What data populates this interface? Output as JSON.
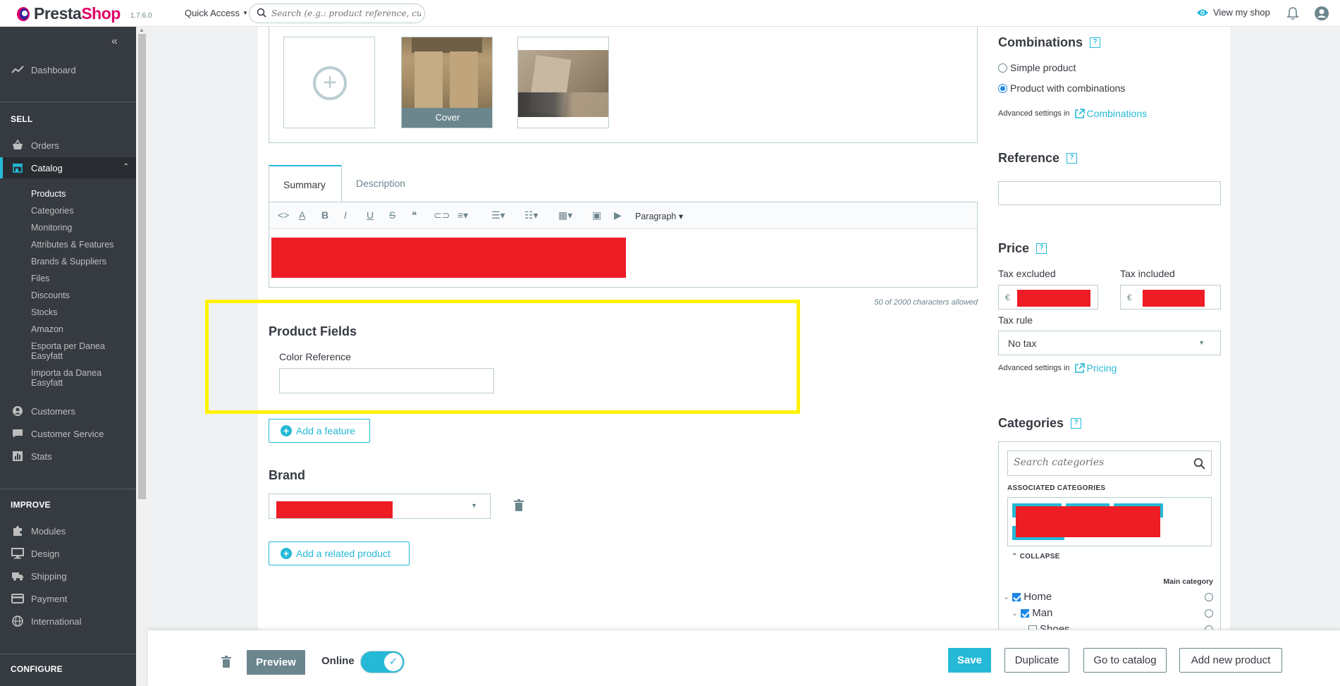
{
  "header": {
    "logo_text_a": "Presta",
    "logo_text_b": "Shop",
    "version": "1.7.6.0",
    "quick_access": "Quick Access",
    "search_placeholder": "Search (e.g.: product reference, customer name…)",
    "view_shop": "View my shop"
  },
  "sidebar": {
    "dashboard": "Dashboard",
    "sell": "SELL",
    "orders": "Orders",
    "catalog": "Catalog",
    "catalog_sub": [
      "Products",
      "Categories",
      "Monitoring",
      "Attributes & Features",
      "Brands & Suppliers",
      "Files",
      "Discounts",
      "Stocks",
      "Amazon",
      "Esporta per Danea Easyfatt",
      "Importa da Danea Easyfatt"
    ],
    "customers": "Customers",
    "customer_service": "Customer Service",
    "stats": "Stats",
    "improve": "IMPROVE",
    "modules": "Modules",
    "design": "Design",
    "shipping": "Shipping",
    "payment": "Payment",
    "international": "International",
    "configure": "CONFIGURE"
  },
  "images": {
    "cover_label": "Cover"
  },
  "editor": {
    "tab_summary": "Summary",
    "tab_description": "Description",
    "paragraph": "Paragraph",
    "char_count": "50 of 2000 characters allowed"
  },
  "product_fields": {
    "title": "Product Fields",
    "color_label": "Color Reference",
    "color_value": ""
  },
  "features": {
    "add_feature": "Add a feature",
    "brand_title": "Brand",
    "add_related": "Add a related product"
  },
  "right": {
    "combinations_title": "Combinations",
    "simple_product": "Simple product",
    "with_combinations": "Product with combinations",
    "advanced_in": "Advanced settings in",
    "combinations_link": "Combinations",
    "reference_title": "Reference",
    "price_title": "Price",
    "tax_excluded": "Tax excluded",
    "tax_included": "Tax included",
    "currency": "€",
    "tax_rule": "Tax rule",
    "tax_value": "No tax",
    "pricing_link": "Pricing",
    "categories_title": "Categories",
    "search_categories": "Search categories",
    "associated": "ASSOCIATED CATEGORIES",
    "collapse": "COLLAPSE",
    "main_category": "Main category",
    "tree": [
      "Home",
      "Man",
      "Shoes"
    ]
  },
  "footer": {
    "preview": "Preview",
    "online": "Online",
    "save": "Save",
    "duplicate": "Duplicate",
    "go_catalog": "Go to catalog",
    "add_new": "Add new product"
  },
  "colors": {
    "accent": "#25b9d7",
    "sidebar_bg": "#363a41",
    "highlight": "#fff200",
    "redaction": "#ee1c25"
  }
}
